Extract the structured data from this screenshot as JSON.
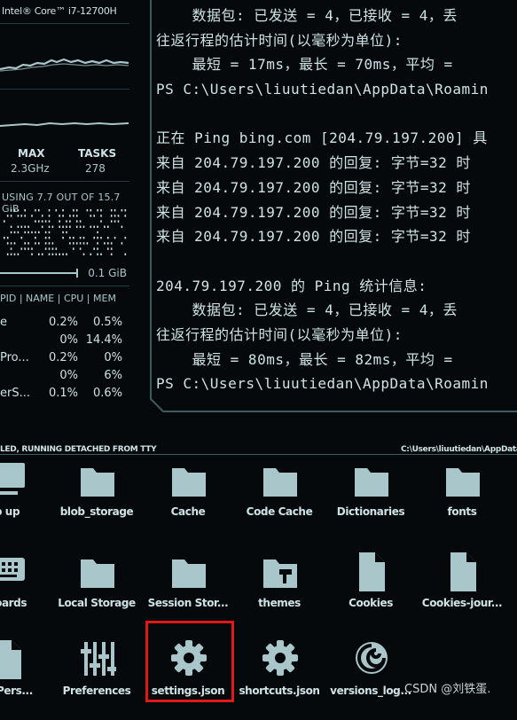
{
  "system": {
    "cpu_title": "Intel® Core™ i7-12700H",
    "stats": [
      {
        "header": "MAX",
        "value": "2.3GHz"
      },
      {
        "header": "TASKS",
        "value": "278"
      }
    ],
    "memory_title": "USING 7.7 OUT OF 15.7 GiB",
    "swap": "0.1 GiB",
    "process_header": "PID | NAME | CPU | MEM",
    "processes": [
      {
        "name": "e",
        "cpu": "0.2%",
        "mem": "0.5%"
      },
      {
        "name": "",
        "cpu": "0%",
        "mem": "14.4%"
      },
      {
        "name": "Pro...",
        "cpu": "0.2%",
        "mem": "0%"
      },
      {
        "name": "",
        "cpu": "0%",
        "mem": "6%"
      },
      {
        "name": "erS...",
        "cpu": "0.1%",
        "mem": "0.6%"
      }
    ]
  },
  "terminal": {
    "lines": [
      "    数据包: 已发送 = 4，已接收 = 4，丢",
      "往返行程的估计时间(以毫秒为单位):",
      "    最短 = 17ms，最长 = 70ms，平均 =",
      "PS C:\\Users\\liuutiedan\\AppData\\Roamin",
      "",
      "正在 Ping bing.com [204.79.197.200] 具",
      "来自 204.79.197.200 的回复: 字节=32 时",
      "来自 204.79.197.200 的回复: 字节=32 时",
      "来自 204.79.197.200 的回复: 字节=32 时",
      "来自 204.79.197.200 的回复: 字节=32 时",
      "",
      "204.79.197.200 的 Ping 统计信息:",
      "    数据包: 已发送 = 4，已接收 = 4，丢",
      "往返行程的估计时间(以毫秒为单位):",
      "    最短 = 80ms，最长 = 82ms，平均 =",
      "PS C:\\Users\\liuutiedan\\AppData\\Roamin"
    ]
  },
  "filesystem": {
    "status_left": "LED, RUNNING DETACHED FROM TTY",
    "status_right": "C:\\Users\\liuutiedan\\AppData",
    "items": [
      {
        "label": "p up",
        "icon": "monitor-icon"
      },
      {
        "label": "blob_storage",
        "icon": "folder-icon"
      },
      {
        "label": "Cache",
        "icon": "folder-icon"
      },
      {
        "label": "Code Cache",
        "icon": "folder-icon"
      },
      {
        "label": "Dictionaries",
        "icon": "folder-icon"
      },
      {
        "label": "fonts",
        "icon": "folder-icon"
      },
      {
        "label": "boards",
        "icon": "keyboard-icon"
      },
      {
        "label": "Local Storage",
        "icon": "folder-icon"
      },
      {
        "label": "Session Stor...",
        "icon": "folder-icon"
      },
      {
        "label": "themes",
        "icon": "themes-folder-icon"
      },
      {
        "label": "Cookies",
        "icon": "file-icon"
      },
      {
        "label": "Cookies-jour...",
        "icon": "file-icon"
      },
      {
        "label": "rk Pers...",
        "icon": "file-icon"
      },
      {
        "label": "Preferences",
        "icon": "sliders-icon"
      },
      {
        "label": "settings.json",
        "icon": "gear-icon"
      },
      {
        "label": "shortcuts.json",
        "icon": "gear-icon"
      },
      {
        "label": "versions_log...",
        "icon": "swirl-icon"
      }
    ]
  },
  "watermark": "CSDN @刘铁蛋.",
  "colors": {
    "accent": "#a9c6cb",
    "background": "#05090b",
    "highlight": "#e01818"
  }
}
